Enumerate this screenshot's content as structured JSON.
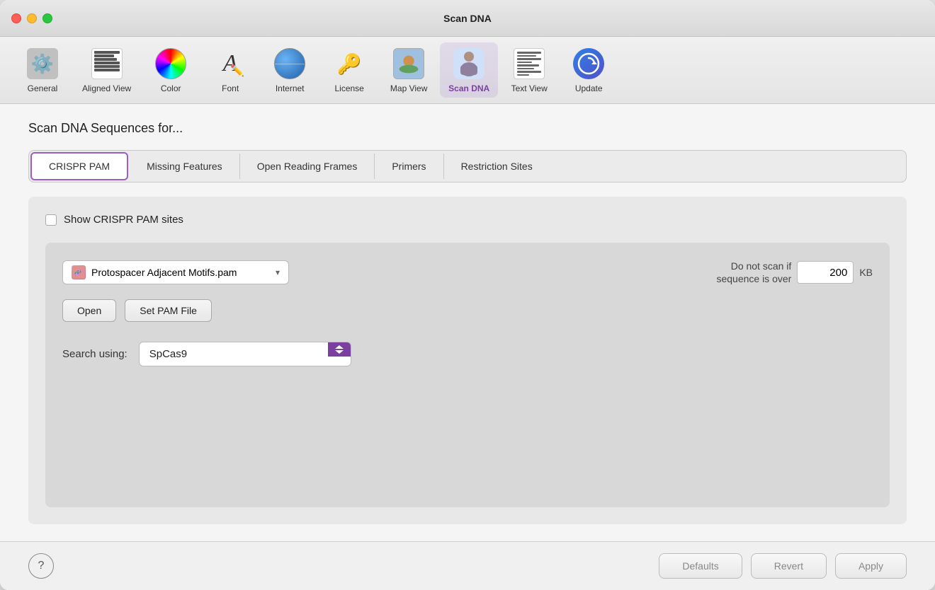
{
  "window": {
    "title": "Scan DNA"
  },
  "toolbar": {
    "items": [
      {
        "id": "general",
        "label": "General",
        "icon": "general-icon"
      },
      {
        "id": "aligned-view",
        "label": "Aligned View",
        "icon": "aligned-view-icon"
      },
      {
        "id": "color",
        "label": "Color",
        "icon": "color-icon"
      },
      {
        "id": "font",
        "label": "Font",
        "icon": "font-icon"
      },
      {
        "id": "internet",
        "label": "Internet",
        "icon": "internet-icon"
      },
      {
        "id": "license",
        "label": "License",
        "icon": "license-icon"
      },
      {
        "id": "map-view",
        "label": "Map View",
        "icon": "map-view-icon"
      },
      {
        "id": "scan-dna",
        "label": "Scan DNA",
        "icon": "scan-dna-icon",
        "active": true
      },
      {
        "id": "text-view",
        "label": "Text View",
        "icon": "text-view-icon"
      },
      {
        "id": "update",
        "label": "Update",
        "icon": "update-icon"
      }
    ]
  },
  "main": {
    "section_title": "Scan DNA Sequences for...",
    "tabs": [
      {
        "id": "crispr-pam",
        "label": "CRISPR PAM",
        "active": true
      },
      {
        "id": "missing-features",
        "label": "Missing Features"
      },
      {
        "id": "open-reading-frames",
        "label": "Open Reading Frames"
      },
      {
        "id": "primers",
        "label": "Primers"
      },
      {
        "id": "restriction-sites",
        "label": "Restriction Sites"
      }
    ],
    "checkbox": {
      "label": "Show CRISPR PAM sites",
      "checked": false
    },
    "file_selector": {
      "value": "Protospacer Adjacent Motifs.pam"
    },
    "buttons": {
      "open": "Open",
      "set_pam": "Set PAM File"
    },
    "limit": {
      "label": "Do not scan if\nsequence is over",
      "value": "200",
      "unit": "KB"
    },
    "search": {
      "label": "Search using:",
      "value": "SpCas9"
    }
  },
  "bottom": {
    "help_label": "?",
    "defaults_label": "Defaults",
    "revert_label": "Revert",
    "apply_label": "Apply"
  }
}
